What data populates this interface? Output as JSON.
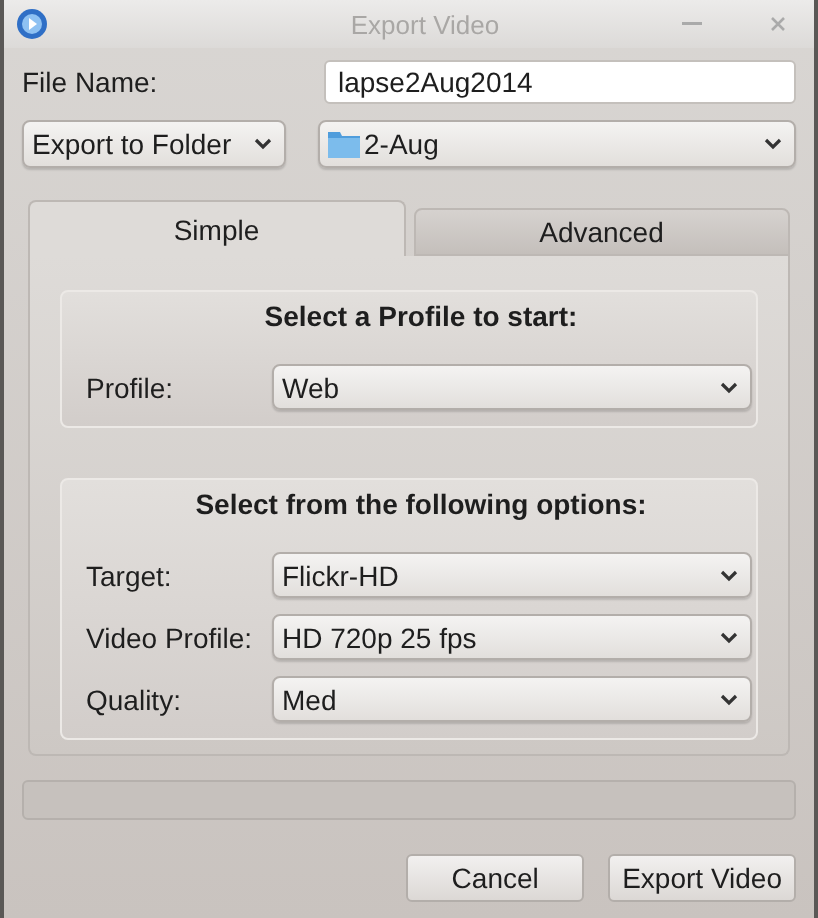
{
  "window": {
    "title": "Export Video",
    "active": false
  },
  "file_name": {
    "label": "File Name:",
    "value": "lapse2Aug2014"
  },
  "destination": {
    "mode": "Export to Folder",
    "folder": "2-Aug"
  },
  "tabs": [
    {
      "label": "Simple",
      "selected": true
    },
    {
      "label": "Advanced",
      "selected": false
    }
  ],
  "groups": [
    {
      "title": "Select a Profile to start:",
      "fields": [
        {
          "label": "Profile:",
          "value": "Web"
        }
      ]
    },
    {
      "title": "Select from the following options:",
      "fields": [
        {
          "label": "Target:",
          "value": "Flickr-HD"
        },
        {
          "label": "Video Profile:",
          "value": "HD 720p 25 fps"
        },
        {
          "label": "Quality:",
          "value": "Med"
        }
      ]
    }
  ],
  "progress": {
    "level": 0
  },
  "buttons": [
    "Cancel",
    "Export Video"
  ]
}
